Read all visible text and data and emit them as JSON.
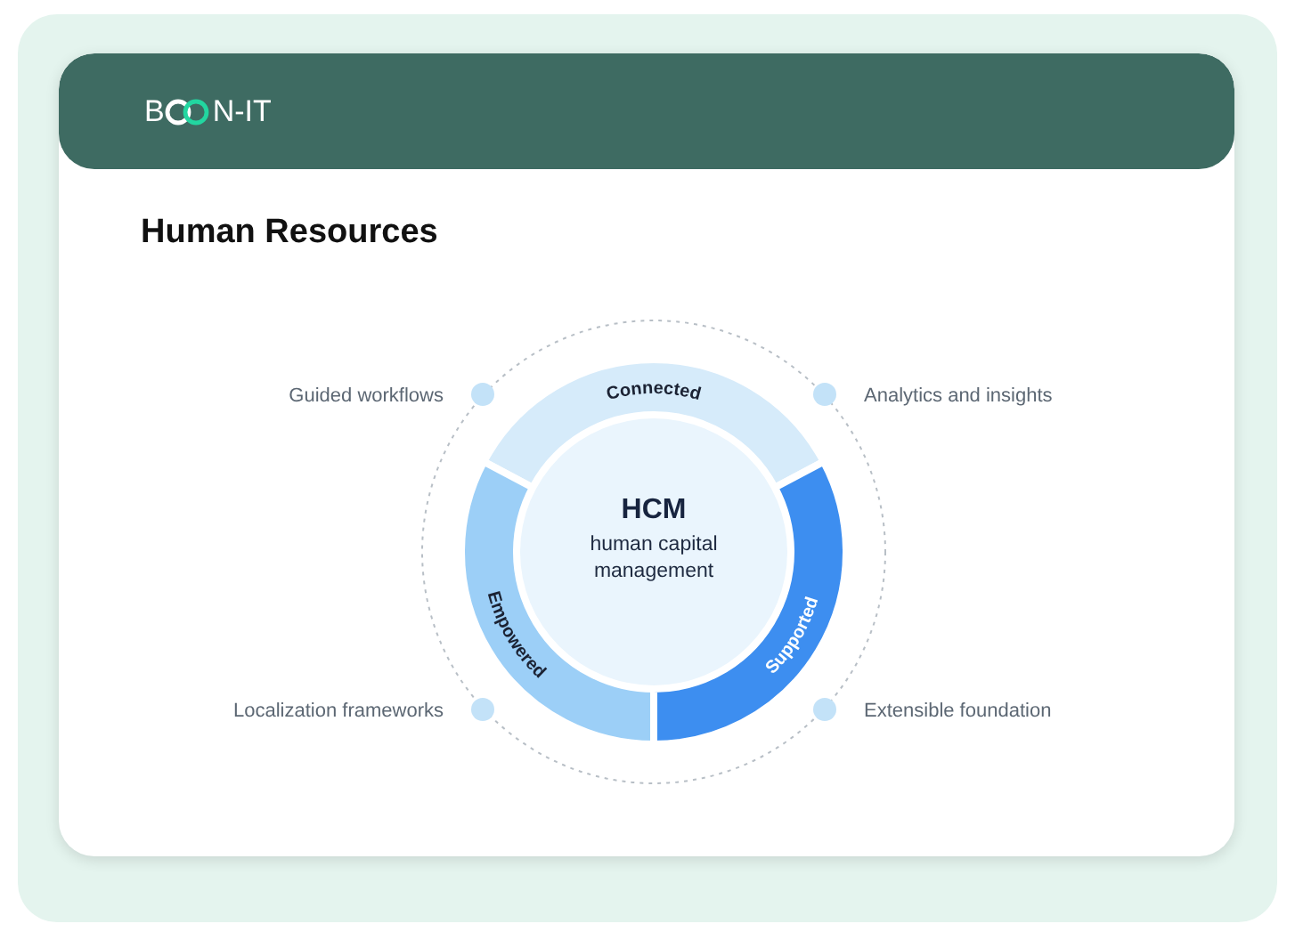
{
  "brand": {
    "prefix": "B",
    "suffix": "N-IT"
  },
  "title": "Human Resources",
  "diagram": {
    "center": {
      "title": "HCM",
      "subtitle": [
        "human capital",
        "management"
      ]
    },
    "segments": [
      {
        "label": "Connected",
        "color": "#d6ebfa"
      },
      {
        "label": "Empowered",
        "color": "#9ccff7"
      },
      {
        "label": "Supported",
        "color": "#3d8ef0"
      }
    ],
    "features": [
      {
        "label": "Guided workflows"
      },
      {
        "label": "Analytics and insights"
      },
      {
        "label": "Localization frameworks"
      },
      {
        "label": "Extensible foundation"
      }
    ]
  }
}
